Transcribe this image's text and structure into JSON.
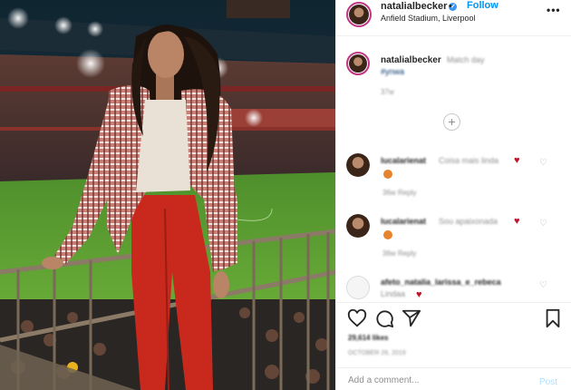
{
  "post": {
    "username": "natalialbecker",
    "follow_label": "Follow",
    "separator": "•",
    "location": "Anfield Stadium, Liverpool",
    "more_label": "•••",
    "caption_text": "Match day",
    "caption_tag": "#ynwa",
    "caption_time": "37w",
    "load_more_label": "+",
    "likes": "29,614 likes",
    "date": "OCTOBER 26, 2019"
  },
  "comments": [
    {
      "user": "lucalarienat",
      "text": "Coisa mais linda",
      "meta": "36w   Reply",
      "icon": "heart-icon"
    },
    {
      "user": "lucalarienat",
      "text": "Sou apaixonada",
      "meta": "36w   Reply",
      "icon": "heart-icon"
    },
    {
      "user": "afeto_natalia_larissa_e_rebeca",
      "text": "Lindaa"
    }
  ],
  "add_comment": {
    "placeholder": "Add a comment...",
    "post_label": "Post"
  },
  "colors": {
    "accent": "#0095f6",
    "verified": "#3897f0",
    "heart": "#c0142b",
    "story_ring": "#c13584"
  }
}
